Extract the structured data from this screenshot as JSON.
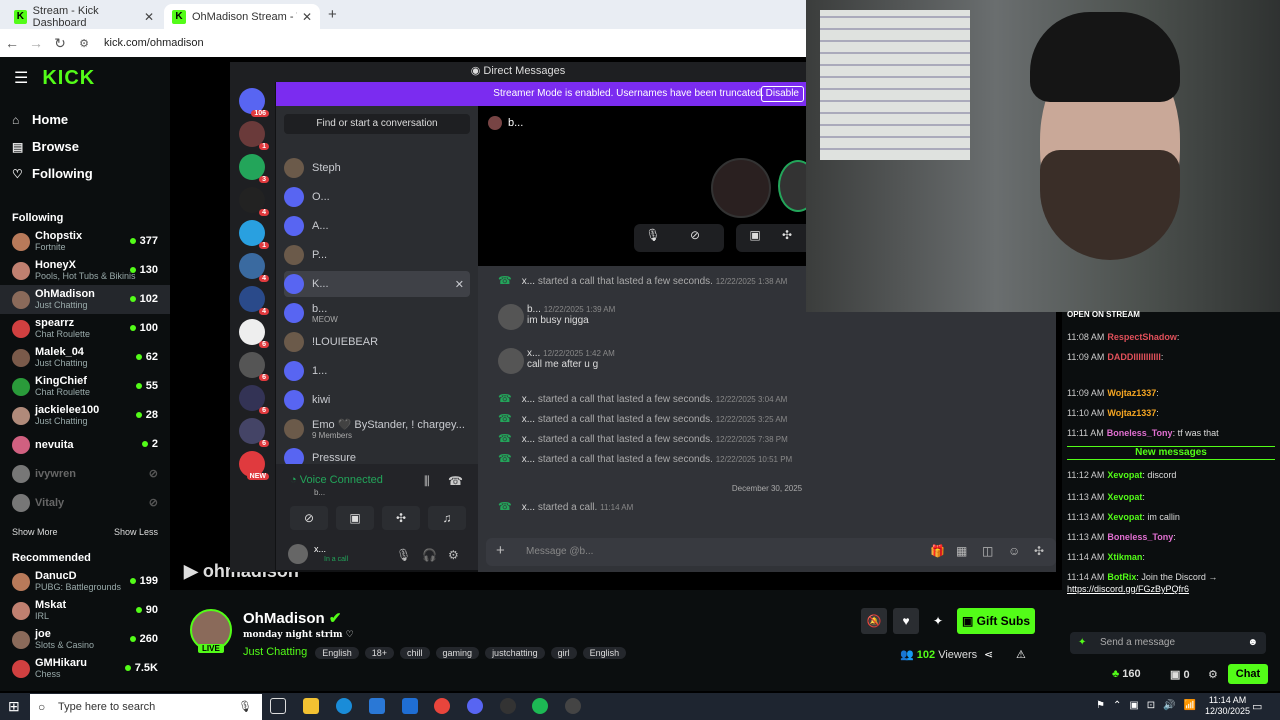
{
  "browser": {
    "tabs": [
      {
        "title": "Stream - Kick Dashboard"
      },
      {
        "title": "OhMadison Stream - Watch"
      }
    ],
    "url": "kick.com/ohmadison"
  },
  "kick": {
    "logo": "KICK",
    "nav": [
      {
        "label": "Home",
        "icon": "home-icon"
      },
      {
        "label": "Browse",
        "icon": "browse-icon"
      },
      {
        "label": "Following",
        "icon": "heart-icon"
      }
    ],
    "following_heading": "Following",
    "following": [
      {
        "name": "Chopstix",
        "sub": "Fortnite",
        "viewers": "377"
      },
      {
        "name": "HoneyX",
        "sub": "Pools, Hot Tubs & Bikinis",
        "viewers": "130"
      },
      {
        "name": "OhMadison",
        "sub": "Just Chatting",
        "viewers": "102"
      },
      {
        "name": "spearrz",
        "sub": "Chat Roulette",
        "viewers": "100"
      },
      {
        "name": "Malek_04",
        "sub": "Just Chatting",
        "viewers": "62"
      },
      {
        "name": "KingChief",
        "sub": "Chat Roulette",
        "viewers": "55"
      },
      {
        "name": "jackielee100",
        "sub": "Just Chatting",
        "viewers": "28"
      },
      {
        "name": "nevuita",
        "sub": "",
        "viewers": "2"
      },
      {
        "name": "ivywren",
        "sub": "",
        "viewers": ""
      },
      {
        "name": "Vitaly",
        "sub": "",
        "viewers": ""
      }
    ],
    "show_more": "Show More",
    "show_less": "Show Less",
    "recommended_heading": "Recommended",
    "recommended": [
      {
        "name": "DanucD",
        "sub": "PUBG: Battlegrounds",
        "viewers": "199"
      },
      {
        "name": "Mskat",
        "sub": "IRL",
        "viewers": "90"
      },
      {
        "name": "joe",
        "sub": "Slots & Casino",
        "viewers": "260"
      },
      {
        "name": "GMHikaru",
        "sub": "Chess",
        "viewers": "7.5K"
      }
    ]
  },
  "discord": {
    "title": "Direct Messages",
    "banner": "Streamer Mode is enabled. Usernames have been truncated.",
    "disable": "Disable",
    "find": "Find or start a conversation",
    "dms": [
      {
        "name": "Steph",
        "sub": ""
      },
      {
        "name": "O...",
        "sub": ""
      },
      {
        "name": "A...",
        "sub": ""
      },
      {
        "name": "P...",
        "sub": ""
      },
      {
        "name": "K...",
        "sub": ""
      },
      {
        "name": "b...",
        "sub": "MEOW"
      },
      {
        "name": "!LOUIEBEAR",
        "sub": ""
      },
      {
        "name": "1...",
        "sub": ""
      },
      {
        "name": "kiwi",
        "sub": ""
      },
      {
        "name": "Emo 🖤 ByStander, ! chargey...",
        "sub": "9 Members"
      },
      {
        "name": "Pressure",
        "sub": ""
      }
    ],
    "server_badges": [
      "106",
      "1",
      "3",
      "4",
      "1",
      "4",
      "4",
      "6",
      "6",
      "6",
      "6",
      "NEW"
    ],
    "voice_status": "Voice Connected",
    "voice_channel": "b...",
    "user_name": "x...",
    "user_status": "In a call",
    "chat_header": "b...",
    "messages": [
      {
        "type": "call",
        "who": "x...",
        "text": "started a call that lasted a few seconds.",
        "ts": "12/22/2025 1:38 AM"
      },
      {
        "type": "msg",
        "who": "b...",
        "ts": "12/22/2025 1:39 AM",
        "text": "im busy nigga"
      },
      {
        "type": "msg",
        "who": "x...",
        "ts": "12/22/2025 1:42 AM",
        "text": "call me after u g"
      },
      {
        "type": "call",
        "who": "x...",
        "text": "started a call that lasted a few seconds.",
        "ts": "12/22/2025 3:04 AM"
      },
      {
        "type": "call",
        "who": "x...",
        "text": "started a call that lasted a few seconds.",
        "ts": "12/22/2025 3:25 AM"
      },
      {
        "type": "call",
        "who": "x...",
        "text": "started a call that lasted a few seconds.",
        "ts": "12/22/2025 7:38 PM"
      },
      {
        "type": "call",
        "who": "x...",
        "text": "started a call that lasted a few seconds.",
        "ts": "12/22/2025 10:51 PM"
      },
      {
        "type": "call",
        "who": "x...",
        "text": "started a call.",
        "ts": "11:14 AM"
      }
    ],
    "date_divider": "December 30, 2025",
    "input_placeholder": "Message @b..."
  },
  "chat": {
    "header_partial": "OPEN ON STREAM",
    "lines": [
      {
        "t": "11:08 AM",
        "u": "RespectShadow",
        "c": "#e0505a",
        "m": ":"
      },
      {
        "t": "11:09 AM",
        "u": "DADDIIIIIIIIIII",
        "c": "#e0505a",
        "m": ":"
      },
      {
        "t": "11:09 AM",
        "u": "Wojtaz1337",
        "c": "#f5a623",
        "m": ":"
      },
      {
        "t": "11:10 AM",
        "u": "Wojtaz1337",
        "c": "#f5a623",
        "m": ":"
      },
      {
        "t": "11:11 AM",
        "u": "Boneless_Tony",
        "c": "#e06fd0",
        "m": ": tf was that"
      },
      {
        "t": "11:12 AM",
        "u": "Xevopat",
        "c": "#53fc18",
        "m": ": discord"
      },
      {
        "t": "11:13 AM",
        "u": "Xevopat",
        "c": "#53fc18",
        "m": ":"
      },
      {
        "t": "11:13 AM",
        "u": "Xevopat",
        "c": "#53fc18",
        "m": ": im callin"
      },
      {
        "t": "11:13 AM",
        "u": "Boneless_Tony",
        "c": "#e06fd0",
        "m": ":"
      },
      {
        "t": "11:14 AM",
        "u": "Xtikman",
        "c": "#53fc18",
        "m": ":"
      },
      {
        "t": "11:14 AM",
        "u": "BotRix",
        "c": "#53fc18",
        "m": ": Join the Discord →"
      }
    ],
    "new_messages": "New messages",
    "discord_link": "https://discord.gg/FGzByPQfr6",
    "send_placeholder": "Send a message",
    "points": "160",
    "gifts": "0",
    "chat_button": "Chat"
  },
  "stream": {
    "channel": "OhMadison",
    "title": "monday night strim ♡",
    "category": "Just Chatting",
    "tags": [
      "English",
      "18+",
      "chill",
      "gaming",
      "justchatting",
      "girl",
      "English"
    ],
    "live": "LIVE",
    "viewers": "102",
    "viewers_label": "Viewers",
    "gift_subs": "Gift Subs",
    "watermark": "ohmadison"
  },
  "taskbar": {
    "search_placeholder": "Type here to search",
    "time": "11:14 AM",
    "date": "12/30/2025"
  }
}
